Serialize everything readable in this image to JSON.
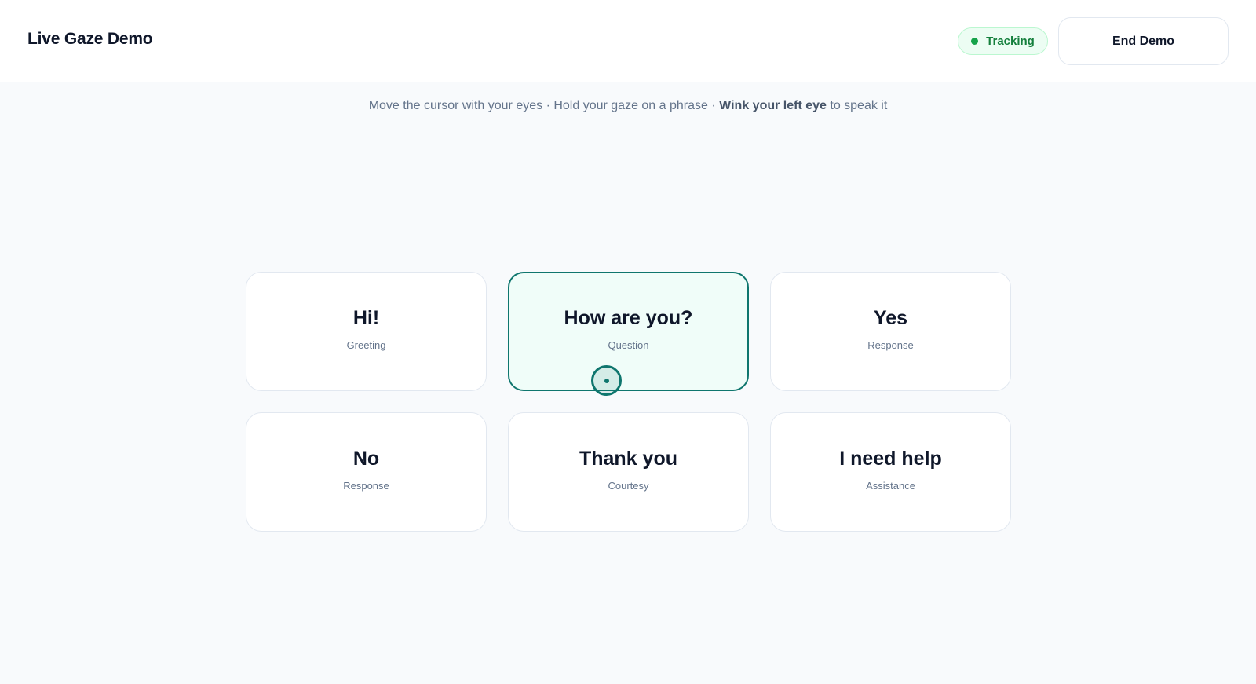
{
  "header": {
    "title": "Live Gaze Demo",
    "status": {
      "label": "Tracking",
      "color": "#15803d",
      "dot_color": "#16a34a"
    },
    "end_button_label": "End Demo"
  },
  "instructions": {
    "part1": "Move the cursor with your eyes · Hold your gaze on a phrase · ",
    "emphasis": "Wink your left eye",
    "part2": " to speak it"
  },
  "phrases": [
    {
      "phrase": "Hi!",
      "category": "Greeting",
      "active": false
    },
    {
      "phrase": "How are you?",
      "category": "Question",
      "active": true
    },
    {
      "phrase": "Yes",
      "category": "Response",
      "active": false
    },
    {
      "phrase": "No",
      "category": "Response",
      "active": false
    },
    {
      "phrase": "Thank you",
      "category": "Courtesy",
      "active": false
    },
    {
      "phrase": "I need help",
      "category": "Assistance",
      "active": false
    }
  ],
  "gaze_cursor": {
    "icon": "gaze-cursor-icon",
    "color": "#0f766e"
  },
  "colors": {
    "accent": "#0f766e",
    "active_card_bg": "#f0fdf9"
  }
}
